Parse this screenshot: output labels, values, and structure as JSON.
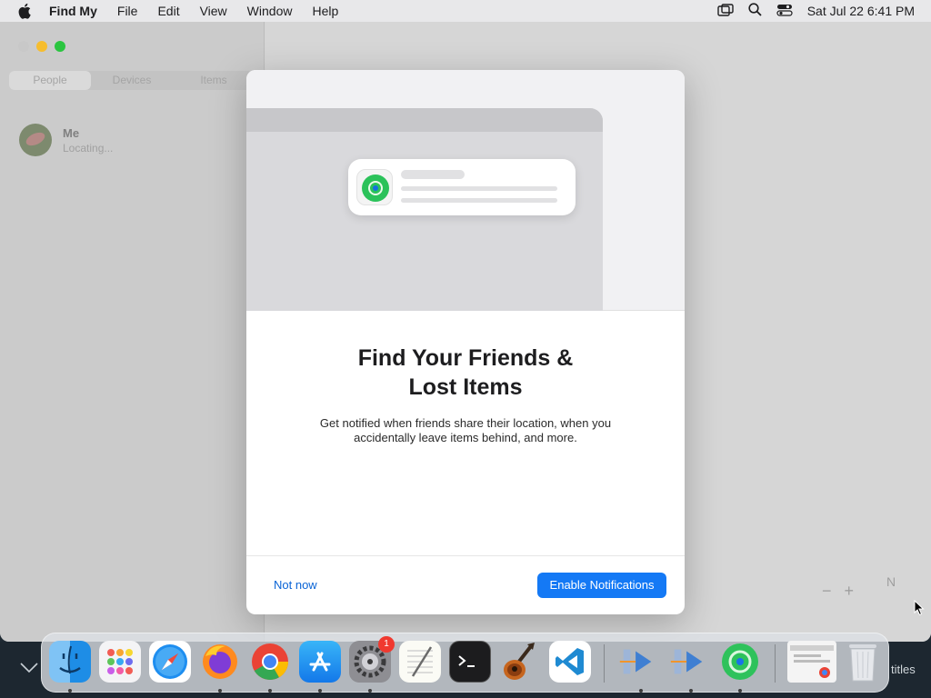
{
  "menubar": {
    "app": "Find My",
    "items": [
      "File",
      "Edit",
      "View",
      "Window",
      "Help"
    ],
    "clock": "Sat Jul 22  6:41 PM"
  },
  "sidebar": {
    "tabs": [
      "People",
      "Devices",
      "Items"
    ],
    "me_name": "Me",
    "me_status": "Locating..."
  },
  "modal": {
    "title_line1": "Find Your Friends &",
    "title_line2": "Lost Items",
    "description": "Get notified when friends share their location, when you accidentally leave items behind, and more.",
    "secondary_button": "Not now",
    "primary_button": "Enable Notifications"
  },
  "map": {
    "compass_label": "N",
    "zoom_out": "−",
    "zoom_in": "+"
  },
  "dock": {
    "apps": [
      "finder-icon",
      "launchpad-icon",
      "safari-icon",
      "firefox-icon",
      "chrome-icon",
      "app-store-icon",
      "system-settings-icon",
      "textedit-icon",
      "terminal-icon",
      "garageband-icon",
      "vscode-icon",
      "migration-icon",
      "migration-icon",
      "find-my-icon",
      "chrome-window-icon",
      "trash-icon"
    ],
    "settings_badge": "1"
  },
  "bottom": {
    "titles_text": "titles"
  },
  "colors": {
    "accent": "#1479f5",
    "link": "#0a64d6"
  }
}
